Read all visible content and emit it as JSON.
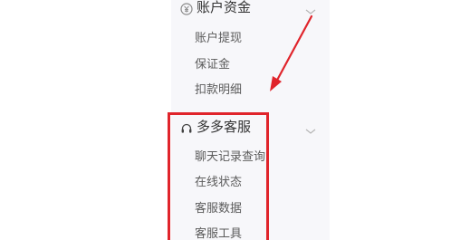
{
  "sidebar": {
    "sections": [
      {
        "title": "账户资金",
        "icon": "yen-circle-icon",
        "items": [
          "账户提现",
          "保证金",
          "扣款明细"
        ]
      },
      {
        "title": "多多客服",
        "icon": "headset-icon",
        "items": [
          "聊天记录查询",
          "在线状态",
          "客服数据",
          "客服工具"
        ]
      }
    ]
  },
  "colors": {
    "annotation": "#e0242b",
    "sidebar_bg": "#f7f7fa",
    "title_text": "#333333",
    "item_text": "#5b5b5b"
  }
}
